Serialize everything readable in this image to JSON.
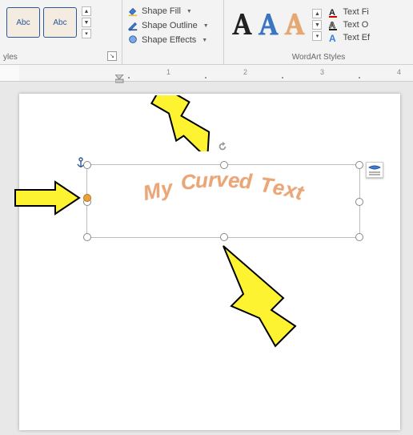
{
  "ribbon": {
    "shape_styles": {
      "title": "yles",
      "box_label": "Abc",
      "fill": "Shape Fill",
      "outline": "Shape Outline",
      "effects": "Shape Effects"
    },
    "wordart_styles": {
      "title": "WordArt Styles",
      "fill": "Text Fi",
      "outline": "Text O",
      "effects": "Text Ef"
    }
  },
  "ruler": [
    "1",
    "2",
    "3",
    "4"
  ],
  "textbox": {
    "content": "My Curved Text"
  },
  "chart_data": null
}
